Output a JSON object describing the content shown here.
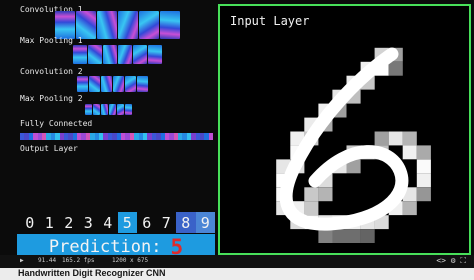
{
  "app": {
    "title": "Handwritten Digit Recognizer CNN"
  },
  "layers": [
    {
      "name": "Convolution 1"
    },
    {
      "name": "Max Pooling 1"
    },
    {
      "name": "Convolution 2"
    },
    {
      "name": "Max Pooling 2"
    },
    {
      "name": "Fully Connected"
    },
    {
      "name": "Output Layer"
    }
  ],
  "input": {
    "title": "Input Layer"
  },
  "output": {
    "digits": [
      "0",
      "1",
      "2",
      "3",
      "4",
      "5",
      "6",
      "7",
      "8",
      "9"
    ],
    "activations": [
      0,
      0,
      0,
      0,
      0,
      1.0,
      0,
      0,
      0.6,
      0.3
    ]
  },
  "prediction": {
    "label": "Prediction:",
    "value": "5"
  },
  "stats": {
    "zoom": "91.44",
    "fps": "165.2 fps",
    "resolution": "1200 x 675"
  },
  "controls": {
    "icons": [
      "code-icon",
      "settings-icon",
      "fullscreen-icon"
    ],
    "text": "<> ⚙ ⛶"
  },
  "colors": {
    "accent": "#1e9be0",
    "prediction_value": "#e02a2a",
    "input_border": "#48e05a"
  }
}
